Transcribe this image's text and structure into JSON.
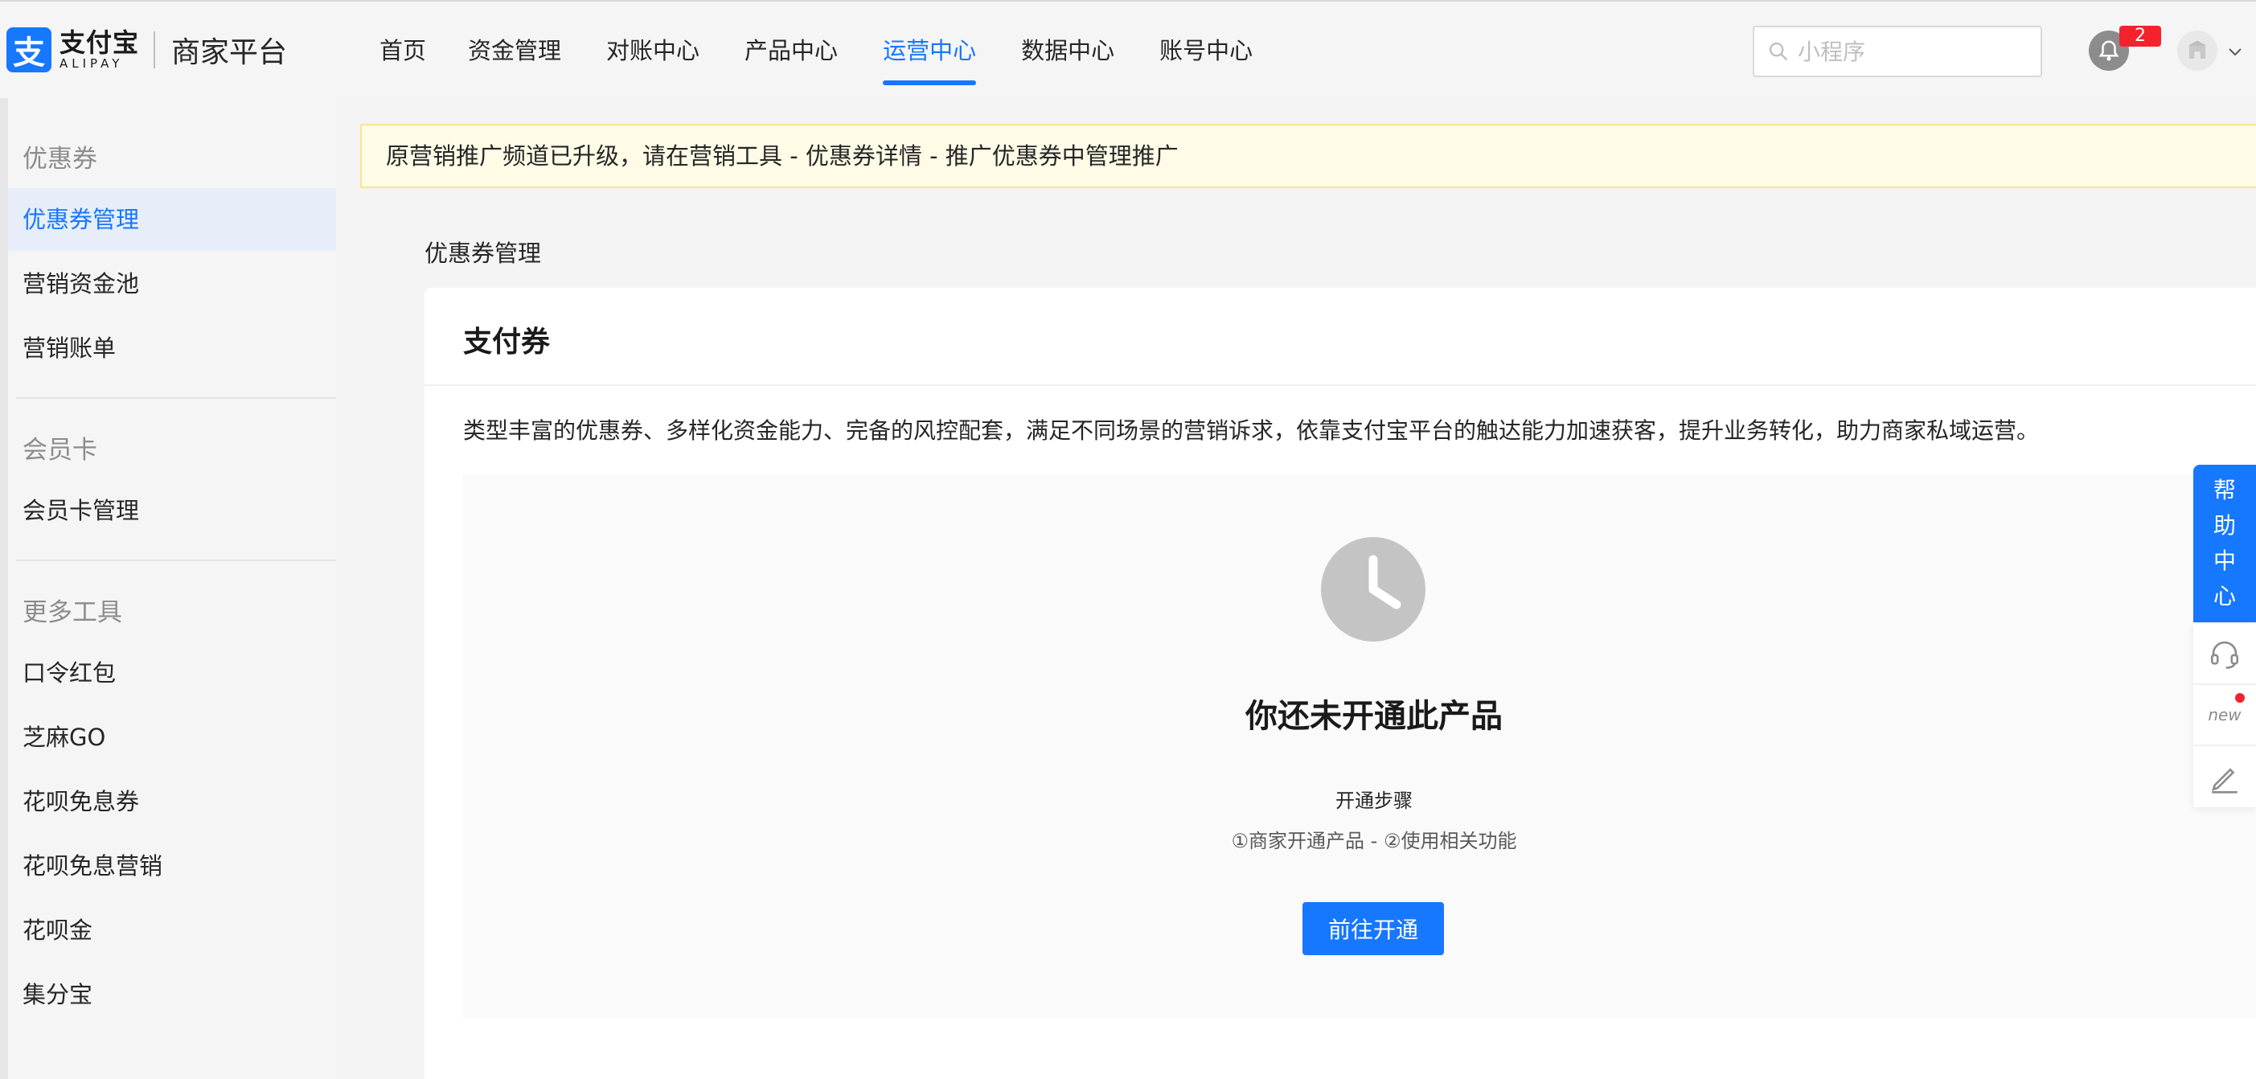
{
  "header": {
    "logo_mark": "支",
    "logo_cn": "支付宝",
    "logo_en": "ALIPAY",
    "platform": "商家平台",
    "nav": [
      {
        "label": "首页"
      },
      {
        "label": "资金管理"
      },
      {
        "label": "对账中心"
      },
      {
        "label": "产品中心"
      },
      {
        "label": "运营中心",
        "active": true
      },
      {
        "label": "数据中心"
      },
      {
        "label": "账号中心"
      }
    ],
    "search_placeholder": "小程序",
    "notification_count": "2"
  },
  "sidebar": {
    "groups": [
      {
        "title": "优惠券",
        "items": [
          "优惠券管理",
          "营销资金池",
          "营销账单"
        ]
      },
      {
        "title": "会员卡",
        "items": [
          "会员卡管理"
        ]
      },
      {
        "title": "更多工具",
        "items": [
          "口令红包",
          "芝麻GO",
          "花呗免息券",
          "花呗免息营销",
          "花呗金",
          "集分宝"
        ]
      }
    ],
    "active_item": "优惠券管理"
  },
  "notice": "原营销推广频道已升级，请在营销工具 - 优惠券详情 - 推广优惠券中管理推广",
  "breadcrumb": "优惠券管理",
  "card": {
    "title": "支付券",
    "description": "类型丰富的优惠券、多样化资金能力、完备的风控配套，满足不同场景的营销诉求，依靠支付宝平台的触达能力加速获客，提升业务转化，助力商家私域运营。",
    "empty_title": "你还未开通此产品",
    "steps_title": "开通步骤",
    "steps_desc": "①商家开通产品 - ②使用相关功能",
    "button": "前往开通"
  },
  "float": {
    "help": [
      "帮",
      "助",
      "中",
      "心"
    ],
    "new_label": "new"
  },
  "colors": {
    "accent": "#1677ff",
    "notice_bg": "#fffbe6",
    "badge": "#f5222d"
  }
}
